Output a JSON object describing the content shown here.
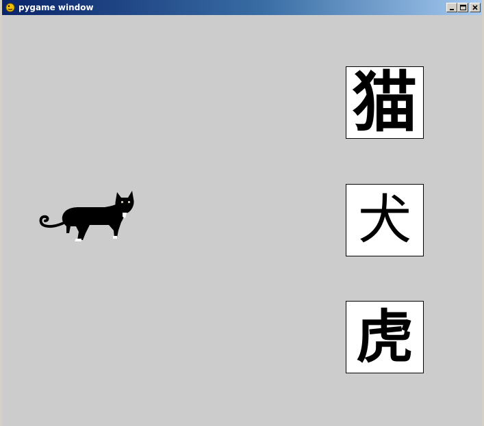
{
  "window": {
    "title": "pygame window",
    "icon": "pygame-snake-icon",
    "controls": [
      "minimize-icon",
      "maximize-icon",
      "close-icon"
    ]
  },
  "game": {
    "background": "#cccccc",
    "sprite": {
      "name": "black-cat",
      "icon": "cat-icon"
    },
    "cards": [
      {
        "character": "猫"
      },
      {
        "character": "犬"
      },
      {
        "character": "虎"
      }
    ]
  }
}
